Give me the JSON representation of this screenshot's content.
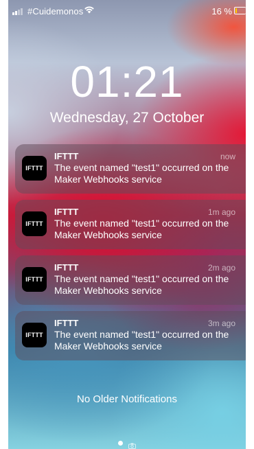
{
  "status_bar": {
    "carrier": "#Cuidemonos",
    "battery_percent": "16 %",
    "battery_level": 0.16,
    "icons": [
      "signal-icon",
      "wifi-icon",
      "battery-icon"
    ]
  },
  "lock_screen": {
    "time": "01:21",
    "date": "Wednesday, 27 October"
  },
  "notifications": [
    {
      "app_icon_text": "IFTTT",
      "app_name": "IFTTT",
      "time": "now",
      "message": "The event named \"test1\" occurred on the Maker Webhooks service"
    },
    {
      "app_icon_text": "IFTTT",
      "app_name": "IFTTT",
      "time": "1m ago",
      "message": "The event named \"test1\" occurred on the Maker Webhooks service"
    },
    {
      "app_icon_text": "IFTTT",
      "app_name": "IFTTT",
      "time": "2m ago",
      "message": "The event named \"test1\" occurred on the Maker Webhooks service"
    },
    {
      "app_icon_text": "IFTTT",
      "app_name": "IFTTT",
      "time": "3m ago",
      "message": "The event named \"test1\" occurred on the Maker Webhooks service"
    }
  ],
  "footer": {
    "no_older_text": "No Older Notifications",
    "page_icons": [
      "page-dot-icon",
      "camera-icon"
    ]
  },
  "colors": {
    "battery_fill": "#ffd200",
    "notification_bg": "rgba(95,75,90,0.5)",
    "app_icon_bg": "#000000"
  }
}
